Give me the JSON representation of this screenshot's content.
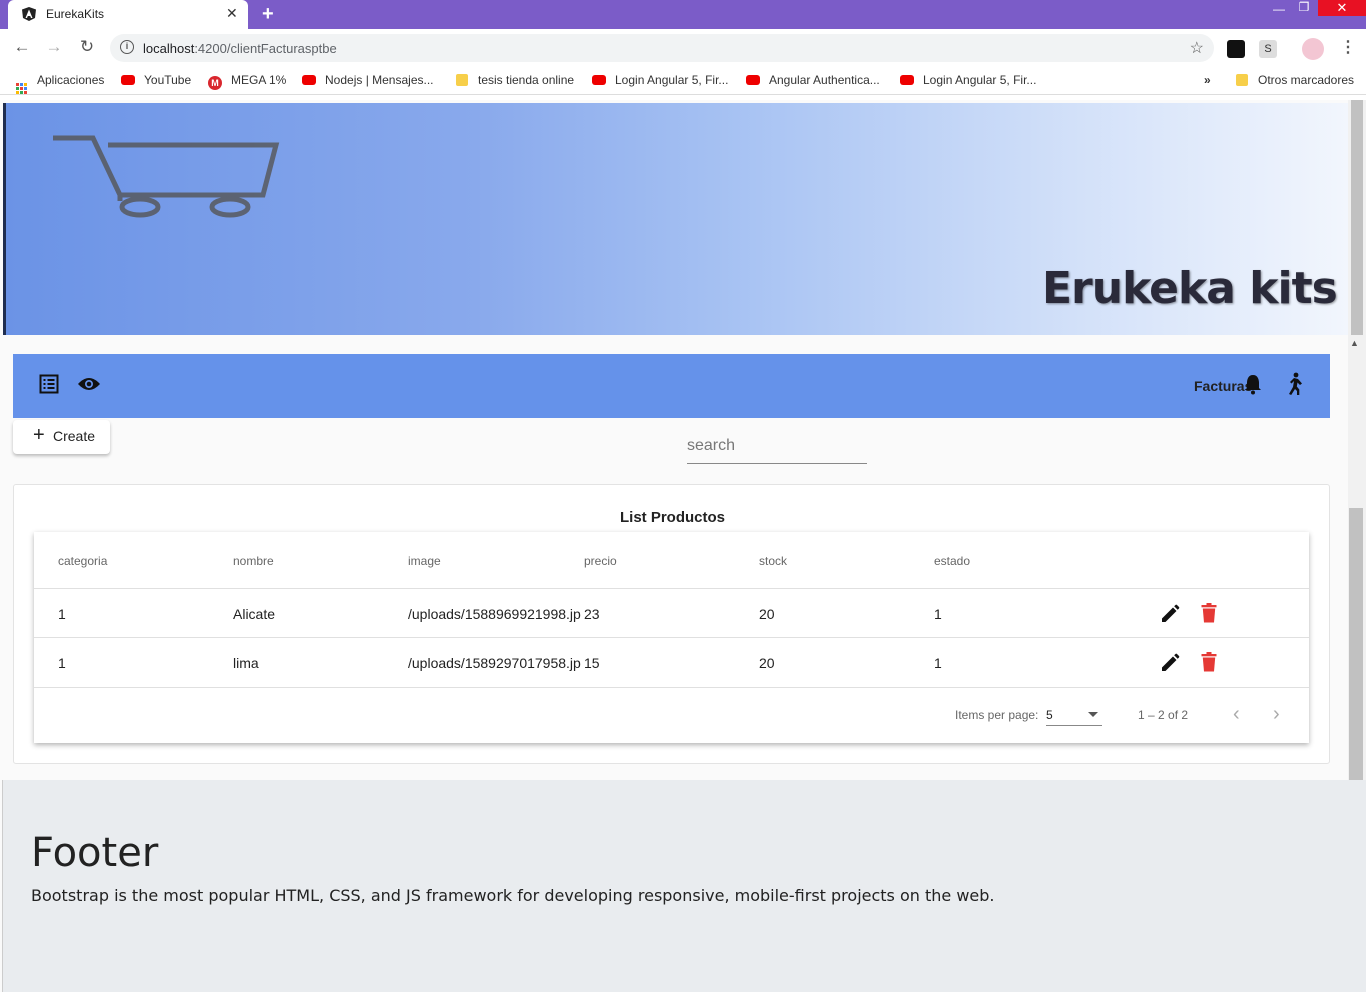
{
  "browser": {
    "tab_title": "EurekaKits",
    "url_host": "localhost",
    "url_path": ":4200/clientFacturasptbe",
    "new_tab": "+",
    "close_tab": "✕"
  },
  "bookmarks": [
    {
      "label": "Aplicaciones",
      "icon": "apps-grid-icon"
    },
    {
      "label": "YouTube",
      "icon": "youtube-icon"
    },
    {
      "label": "MEGA 1%",
      "icon": "mega-icon"
    },
    {
      "label": "Nodejs | Mensajes...",
      "icon": "youtube-icon"
    },
    {
      "label": "tesis tienda online",
      "icon": "folder-icon"
    },
    {
      "label": "Login Angular 5, Fir...",
      "icon": "youtube-icon"
    },
    {
      "label": "Angular Authentica...",
      "icon": "youtube-icon"
    },
    {
      "label": "Login Angular 5, Fir...",
      "icon": "youtube-icon"
    }
  ],
  "bookmarks_more": "»",
  "bookmarks_other": "Otros marcadores",
  "banner": {
    "brand": "Erukeka kits"
  },
  "appbar": {
    "facturas_label": "Facturas"
  },
  "create_label": "Create",
  "search_placeholder": "search",
  "card_title": "List Productos",
  "table": {
    "headers": [
      "categoria",
      "nombre",
      "image",
      "precio",
      "stock",
      "estado"
    ],
    "rows": [
      {
        "categoria": "1",
        "nombre": "Alicate",
        "image": "/uploads/1588969921998.jp",
        "precio": "23",
        "stock": "20",
        "estado": "1"
      },
      {
        "categoria": "1",
        "nombre": "lima",
        "image": "/uploads/1589297017958.jp",
        "precio": "15",
        "stock": "20",
        "estado": "1"
      }
    ]
  },
  "paginator": {
    "items_per_page_label": "Items per page:",
    "page_size": "5",
    "range": "1 – 2 of 2"
  },
  "footer": {
    "title": "Footer",
    "text": "Bootstrap is the most popular HTML, CSS, and JS framework for developing responsive, mobile-first projects on the web."
  },
  "colors": {
    "titlebar": "#7b5cc8",
    "appbar": "#6592ea",
    "delete": "#e53935"
  }
}
